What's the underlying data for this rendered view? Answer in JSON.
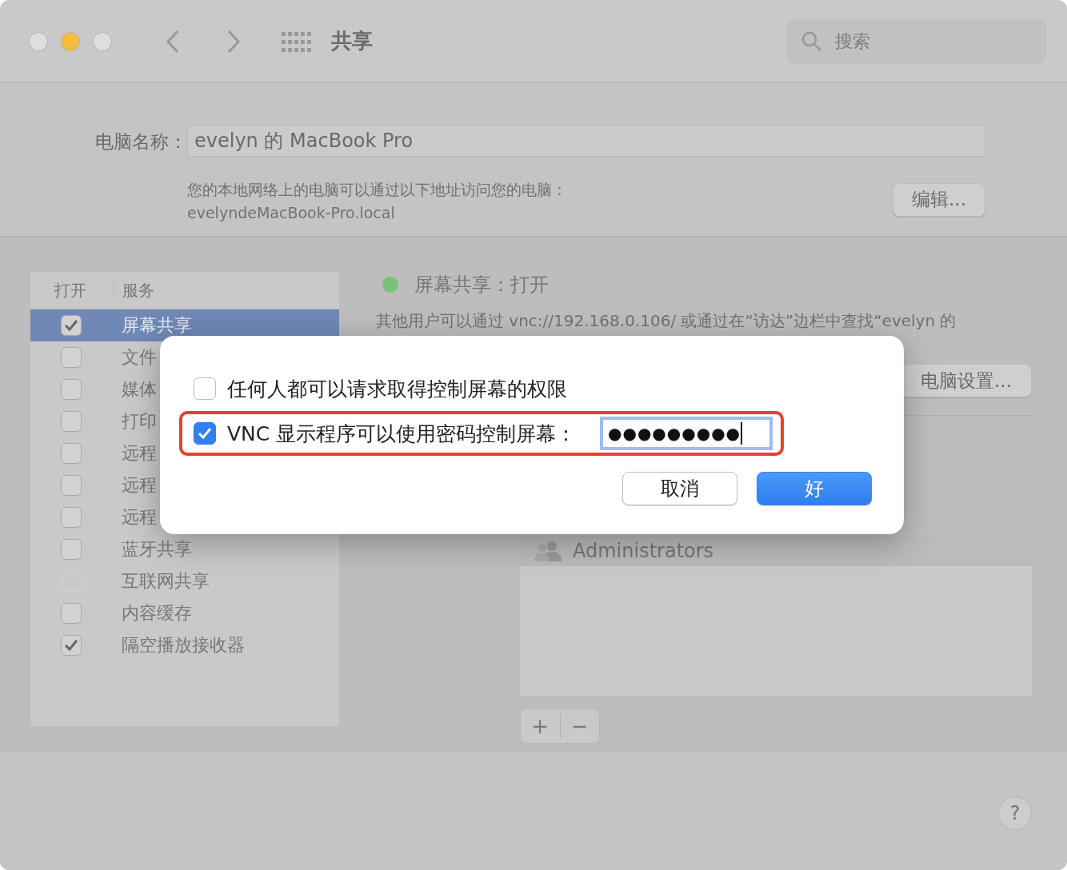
{
  "window": {
    "title": "共享",
    "search": {
      "placeholder": "搜索"
    }
  },
  "computer_name": {
    "label": "电脑名称：",
    "value": "evelyn 的 MacBook Pro",
    "note": "您的本地网络上的电脑可以通过以下地址访问您的电脑：",
    "address": "evelyndeMacBook-Pro.local",
    "edit_button": "编辑..."
  },
  "services": {
    "columns": [
      "打开",
      "服务"
    ],
    "items": [
      {
        "label": "屏幕共享",
        "checked": true,
        "selected": true,
        "disabled": false
      },
      {
        "label": "文件",
        "checked": false,
        "selected": false,
        "disabled": false
      },
      {
        "label": "媒体",
        "checked": false,
        "selected": false,
        "disabled": false
      },
      {
        "label": "打印",
        "checked": false,
        "selected": false,
        "disabled": false
      },
      {
        "label": "远程",
        "checked": false,
        "selected": false,
        "disabled": false
      },
      {
        "label": "远程",
        "checked": false,
        "selected": false,
        "disabled": false
      },
      {
        "label": "远程",
        "checked": false,
        "selected": false,
        "disabled": false
      },
      {
        "label": "蓝牙共享",
        "checked": false,
        "selected": false,
        "disabled": false
      },
      {
        "label": "互联网共享",
        "checked": false,
        "selected": false,
        "disabled": true
      },
      {
        "label": "内容缓存",
        "checked": false,
        "selected": false,
        "disabled": false
      },
      {
        "label": "隔空播放接收器",
        "checked": true,
        "selected": false,
        "disabled": false
      }
    ]
  },
  "detail": {
    "status": {
      "text": "屏幕共享：打开",
      "color": "#79c27a"
    },
    "description": "其他用户可以通过 vnc://192.168.0.106/ 或通过在“访达”边栏中查找“evelyn 的",
    "settings_button": "电脑设置...",
    "users": [
      "Administrators"
    ],
    "add": "+",
    "remove": "−"
  },
  "dialog": {
    "options": [
      {
        "label": "任何人都可以请求取得控制屏幕的权限",
        "checked": false,
        "highlighted": false
      },
      {
        "label": "VNC 显示程序可以使用密码控制屏幕：",
        "checked": true,
        "highlighted": true,
        "password": "●●●●●●●●●"
      }
    ],
    "buttons": [
      {
        "label": "取消",
        "primary": false
      },
      {
        "label": "好",
        "primary": true
      }
    ]
  },
  "help": "?"
}
